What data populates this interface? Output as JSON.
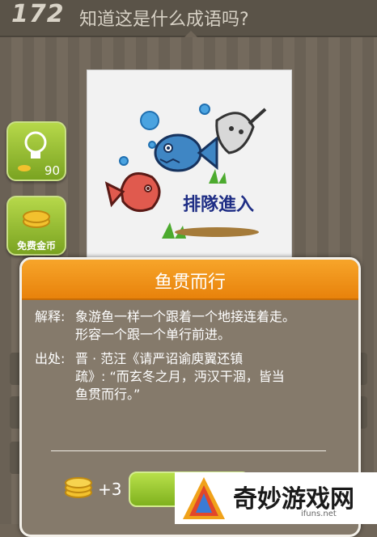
{
  "header": {
    "level": "172",
    "question": "知道这是什么成语吗?"
  },
  "puzzle_image": {
    "caption": "排隊進入"
  },
  "side_buttons": {
    "hint_count": "90",
    "free_coins_label": "免费金币"
  },
  "dialog": {
    "idiom": "鱼贯而行",
    "explanation_label": "解释:",
    "explanation_lines": [
      "象游鱼一样一个跟着一个地接连着走。",
      "形容一个跟一个单行前进。"
    ],
    "source_label": "出处:",
    "source_lines": [
      "晋 · 范汪《请严诏谕庾翼还镇",
      "疏》: “而玄冬之月，沔汉干涸，皆当",
      "鱼贯而行。”"
    ],
    "reward": "+3",
    "next_label": "下"
  },
  "watermark": {
    "name": "奇妙游戏网",
    "url": "ifuns.net"
  }
}
